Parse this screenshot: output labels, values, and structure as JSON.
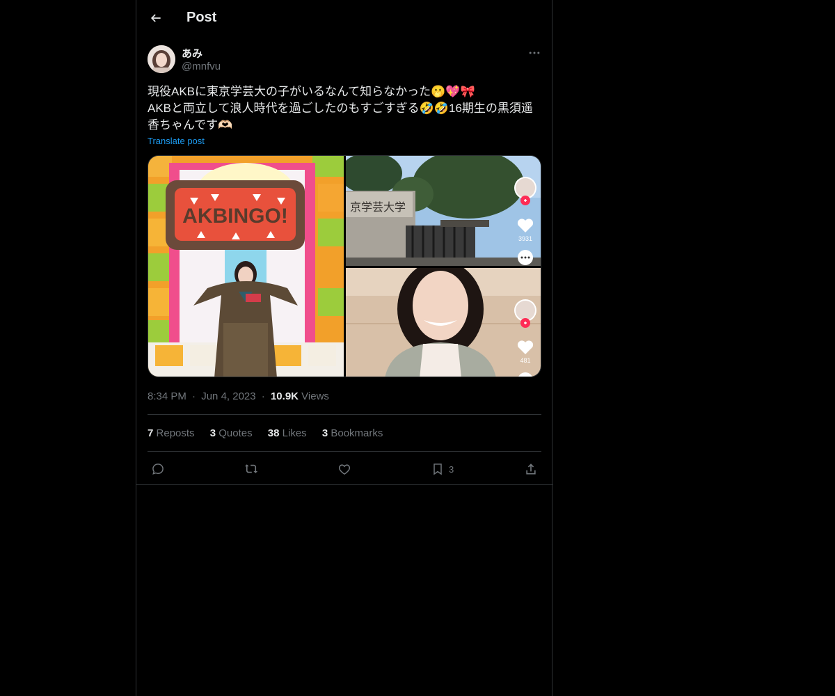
{
  "header": {
    "title": "Post"
  },
  "author": {
    "display_name": "あみ",
    "handle": "@mnfvu"
  },
  "post": {
    "lines": [
      "現役AKBに東京学芸大の子がいるなんて知らなかった🫢💖🎀",
      "AKBと両立して浪人時代を過ごしたのもすごすぎる🤣🤣16期生の黒須遥",
      "香ちゃんです🫶🏻"
    ],
    "translate_label": "Translate post"
  },
  "media": {
    "left_image_text": "AKBINGO!",
    "top_right_sign": "京学芸大学",
    "top_right_likes": "3931",
    "bottom_right_likes": "481"
  },
  "meta": {
    "time": "8:34 PM",
    "sep1": "·",
    "date": "Jun 4, 2023",
    "sep2": "·",
    "views_count": "10.9K",
    "views_label": "Views"
  },
  "stats": {
    "reposts_count": "7",
    "reposts_label": "Reposts",
    "quotes_count": "3",
    "quotes_label": "Quotes",
    "likes_count": "38",
    "likes_label": "Likes",
    "bookmarks_count": "3",
    "bookmarks_label": "Bookmarks"
  },
  "actions": {
    "bookmark_count": "3"
  },
  "colors": {
    "background": "#000000",
    "text": "#e7e9ea",
    "muted": "#71767b",
    "accent": "#1d9bf0",
    "border": "#2f3336"
  }
}
